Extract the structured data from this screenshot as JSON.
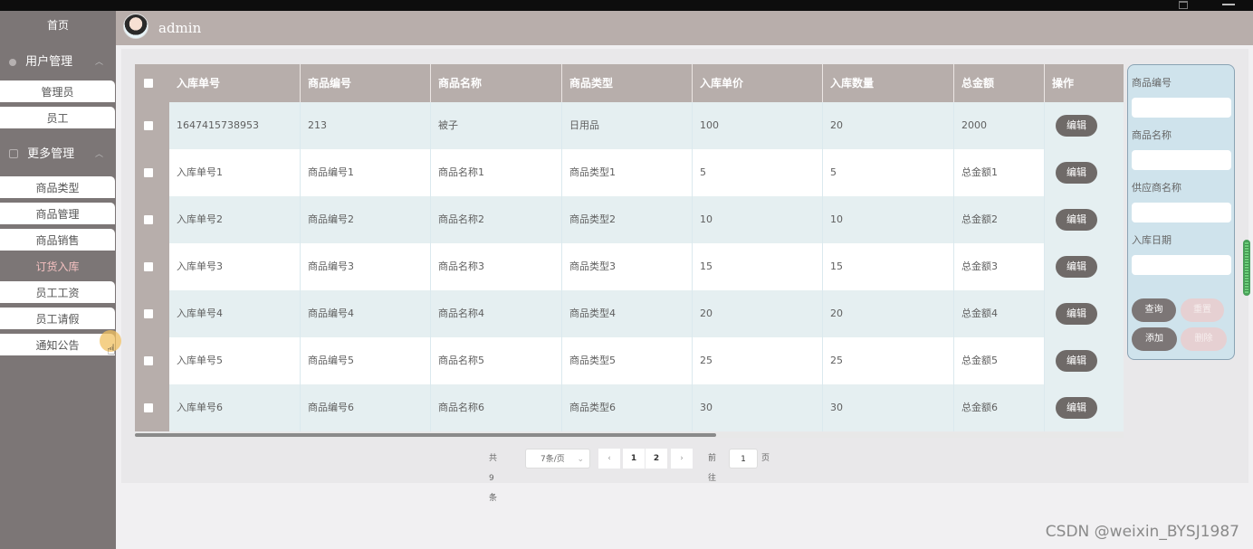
{
  "sidebar": {
    "home": "首页",
    "groups": [
      {
        "label": "用户管理"
      },
      {
        "label": "更多管理"
      }
    ],
    "user_items": [
      "管理员",
      "员工"
    ],
    "more_items": [
      "商品类型",
      "商品管理",
      "商品销售",
      "订货入库",
      "员工工资",
      "员工请假",
      "通知公告"
    ],
    "active_item": "订货入库"
  },
  "header": {
    "username": "admin"
  },
  "table": {
    "columns": [
      "入库单号",
      "商品编号",
      "商品名称",
      "商品类型",
      "入库单价",
      "入库数量",
      "总金额",
      "操作"
    ],
    "edit_label": "编辑",
    "rows": [
      [
        "1647415738953",
        "213",
        "被子",
        "日用品",
        "100",
        "20",
        "2000"
      ],
      [
        "入库单号1",
        "商品编号1",
        "商品名称1",
        "商品类型1",
        "5",
        "5",
        "总金额1"
      ],
      [
        "入库单号2",
        "商品编号2",
        "商品名称2",
        "商品类型2",
        "10",
        "10",
        "总金额2"
      ],
      [
        "入库单号3",
        "商品编号3",
        "商品名称3",
        "商品类型3",
        "15",
        "15",
        "总金额3"
      ],
      [
        "入库单号4",
        "商品编号4",
        "商品名称4",
        "商品类型4",
        "20",
        "20",
        "总金额4"
      ],
      [
        "入库单号5",
        "商品编号5",
        "商品名称5",
        "商品类型5",
        "25",
        "25",
        "总金额5"
      ],
      [
        "入库单号6",
        "商品编号6",
        "商品名称6",
        "商品类型6",
        "30",
        "30",
        "总金额6"
      ]
    ]
  },
  "pagination": {
    "total": "共 9 条",
    "page_size": "7条/页",
    "prev": "‹",
    "pages": [
      "1",
      "2"
    ],
    "next": "›",
    "goto_label": "前往",
    "goto_value": "1",
    "page_unit": "页"
  },
  "search_panel": {
    "fields": [
      "商品编号",
      "商品名称",
      "供应商名称",
      "入库日期"
    ],
    "query": "查询",
    "reset": "重置",
    "add": "添加",
    "delete": "删除"
  },
  "watermark": "CSDN @weixin_BYSJ1987",
  "icons": {
    "user_group": "person-icon",
    "more_group": "box-icon",
    "cursor": "hand-cursor-icon"
  }
}
